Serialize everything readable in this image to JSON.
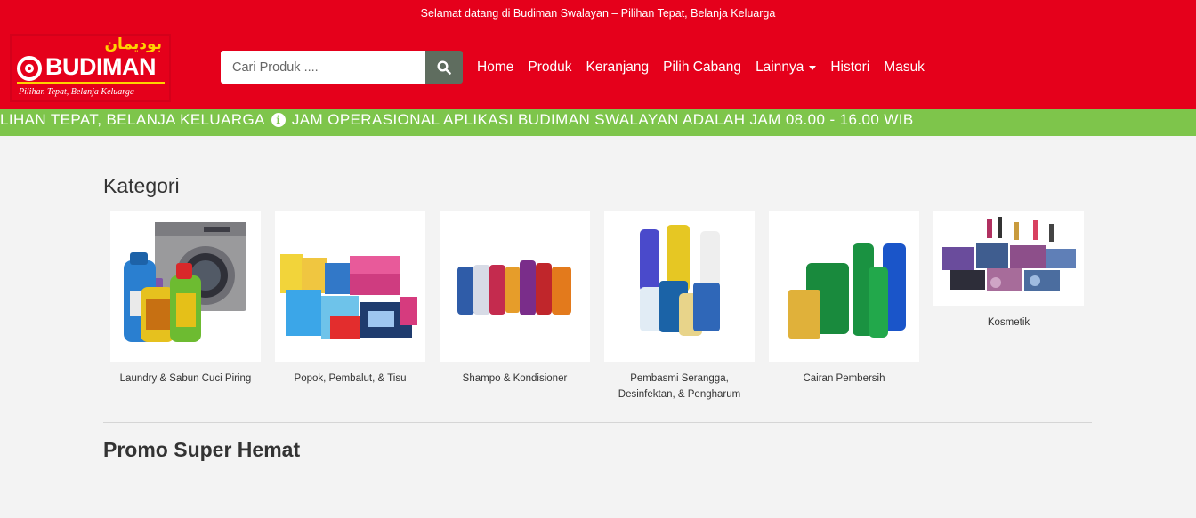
{
  "header": {
    "welcome": "Selamat datang di Budiman Swalayan – Pilihan Tepat, Belanja Keluarga",
    "logo": {
      "arabic": "بوديمان",
      "name": "BUDIMAN",
      "slogan": "Pilihan Tepat, Belanja Keluarga"
    },
    "search": {
      "placeholder": "Cari Produk ...."
    },
    "nav": [
      "Home",
      "Produk",
      "Keranjang",
      "Pilih Cabang",
      "Lainnya",
      "Histori",
      "Masuk"
    ]
  },
  "marquee": {
    "text_before": "LIHAN TEPAT, BELANJA KELUARGA",
    "text_after": "JAM OPERASIONAL APLIKASI BUDIMAN SWALAYAN ADALAH JAM 08.00 - 16.00 WIB"
  },
  "main": {
    "kategori_title": "Kategori",
    "categories": [
      {
        "label": "Laundry & Sabun Cuci Piring"
      },
      {
        "label": "Popok, Pembalut, & Tisu"
      },
      {
        "label": "Shampo & Kondisioner"
      },
      {
        "label": "Pembasmi Serangga, Desinfektan, & Pengharum"
      },
      {
        "label": "Cairan Pembersih"
      },
      {
        "label": "Kosmetik"
      }
    ],
    "promo_title": "Promo Super Hemat"
  },
  "colors": {
    "header": "#e5001b",
    "marquee": "#7ec54b",
    "search_button": "#5f6d5f",
    "logo_accent": "#ffd200"
  }
}
